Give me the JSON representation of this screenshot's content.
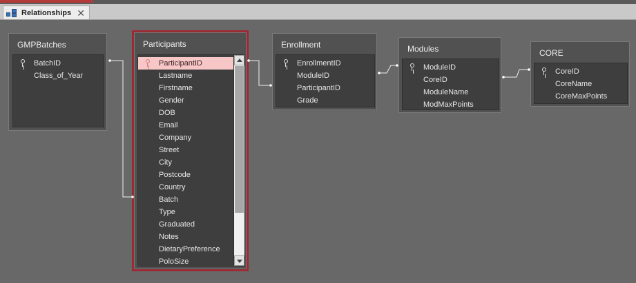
{
  "tab": {
    "label": "Relationships",
    "close_glyph": "✕",
    "icon": "relationships-icon"
  },
  "tables": {
    "gmpbatches": {
      "title": "GMPBatches",
      "fields": [
        {
          "name": "BatchID",
          "key": true
        },
        {
          "name": "Class_of_Year",
          "key": false
        }
      ]
    },
    "participants": {
      "title": "Participants",
      "selected_field": "ParticipantID",
      "fields": [
        {
          "name": "ParticipantID",
          "key": true
        },
        {
          "name": "Lastname",
          "key": false
        },
        {
          "name": "Firstname",
          "key": false
        },
        {
          "name": "Gender",
          "key": false
        },
        {
          "name": "DOB",
          "key": false
        },
        {
          "name": "Email",
          "key": false
        },
        {
          "name": "Company",
          "key": false
        },
        {
          "name": "Street",
          "key": false
        },
        {
          "name": "City",
          "key": false
        },
        {
          "name": "Postcode",
          "key": false
        },
        {
          "name": "Country",
          "key": false
        },
        {
          "name": "Batch",
          "key": false
        },
        {
          "name": "Type",
          "key": false
        },
        {
          "name": "Graduated",
          "key": false
        },
        {
          "name": "Notes",
          "key": false
        },
        {
          "name": "DietaryPreference",
          "key": false
        },
        {
          "name": "PoloSize",
          "key": false
        }
      ]
    },
    "enrollment": {
      "title": "Enrollment",
      "fields": [
        {
          "name": "EnrollmentID",
          "key": true
        },
        {
          "name": "ModuleID",
          "key": false
        },
        {
          "name": "ParticipantID",
          "key": false
        },
        {
          "name": "Grade",
          "key": false
        }
      ]
    },
    "modules": {
      "title": "Modules",
      "fields": [
        {
          "name": "ModuleID",
          "key": true
        },
        {
          "name": "CoreID",
          "key": false
        },
        {
          "name": "ModuleName",
          "key": false
        },
        {
          "name": "ModMaxPoints",
          "key": false
        }
      ]
    },
    "core": {
      "title": "CORE",
      "fields": [
        {
          "name": "CoreID",
          "key": true
        },
        {
          "name": "CoreName",
          "key": false
        },
        {
          "name": "CoreMaxPoints",
          "key": false
        }
      ]
    }
  },
  "colors": {
    "canvas": "#686868",
    "selection_border": "#9b2a32",
    "selected_row": "#f7c7c7"
  }
}
